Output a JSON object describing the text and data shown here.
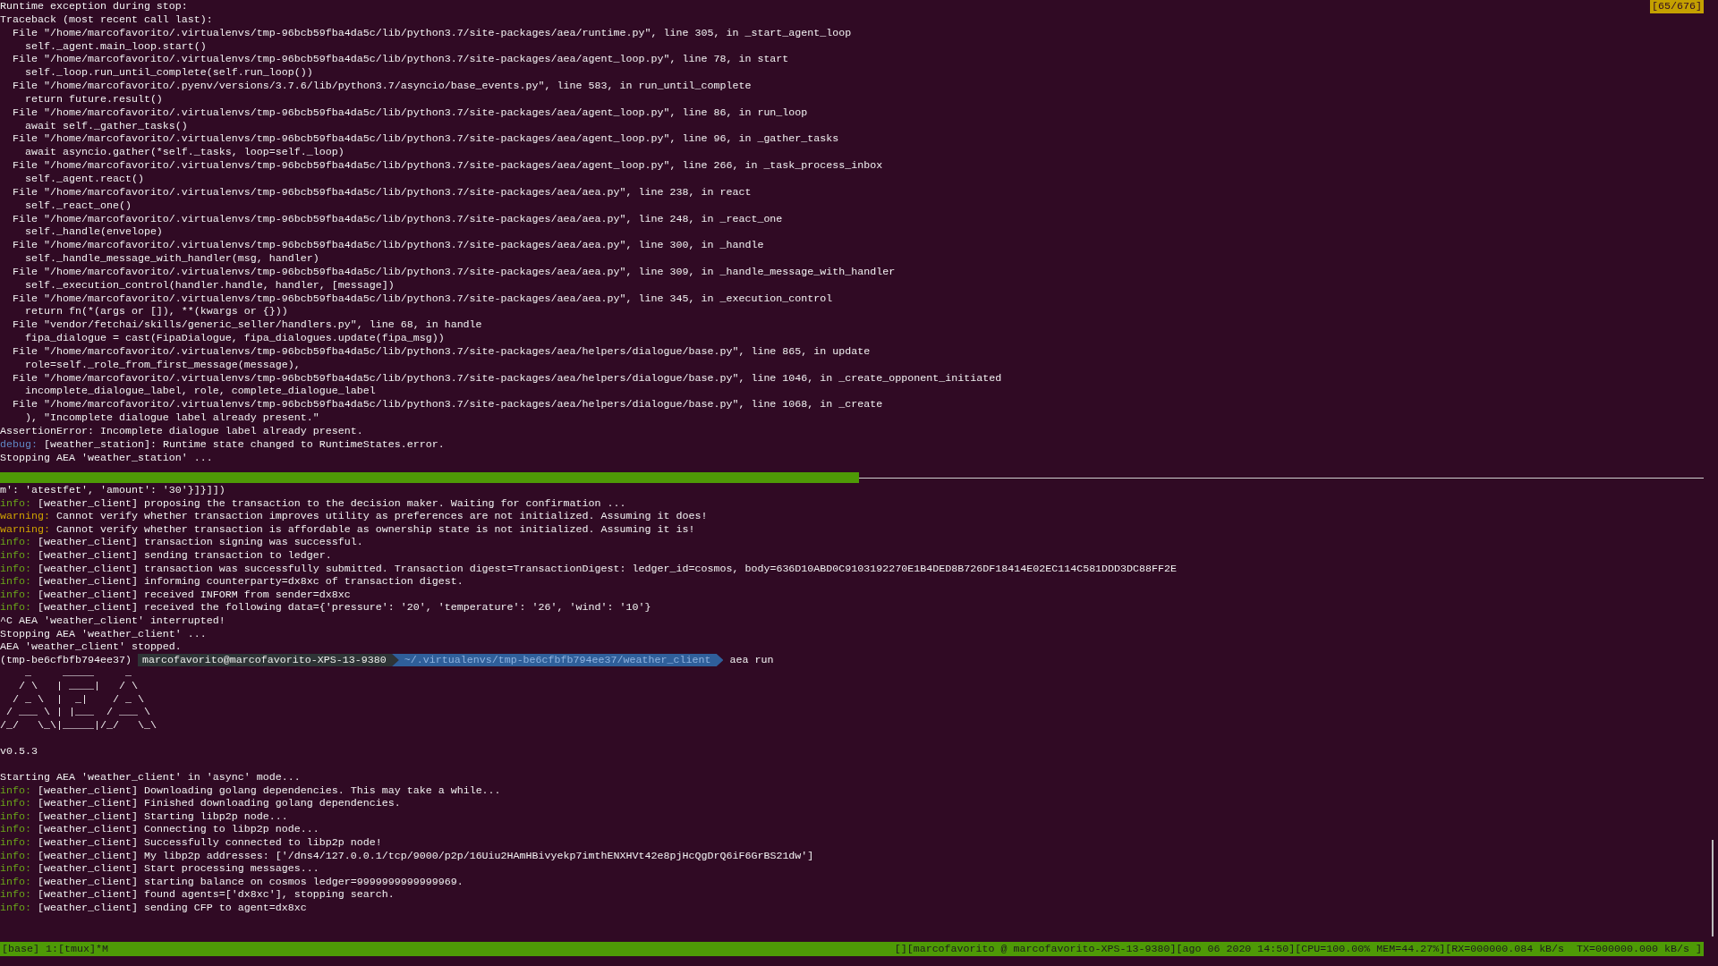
{
  "top_pane": {
    "badge": "[65/676]",
    "lines": [
      {
        "kind": "plain",
        "text": "Runtime exception during stop:"
      },
      {
        "kind": "plain",
        "text": "Traceback (most recent call last):"
      },
      {
        "kind": "plain",
        "text": "  File \"/home/marcofavorito/.virtualenvs/tmp-96bcb59fba4da5c/lib/python3.7/site-packages/aea/runtime.py\", line 305, in _start_agent_loop"
      },
      {
        "kind": "plain",
        "text": "    self._agent.main_loop.start()"
      },
      {
        "kind": "plain",
        "text": "  File \"/home/marcofavorito/.virtualenvs/tmp-96bcb59fba4da5c/lib/python3.7/site-packages/aea/agent_loop.py\", line 78, in start"
      },
      {
        "kind": "plain",
        "text": "    self._loop.run_until_complete(self.run_loop())"
      },
      {
        "kind": "plain",
        "text": "  File \"/home/marcofavorito/.pyenv/versions/3.7.6/lib/python3.7/asyncio/base_events.py\", line 583, in run_until_complete"
      },
      {
        "kind": "plain",
        "text": "    return future.result()"
      },
      {
        "kind": "plain",
        "text": "  File \"/home/marcofavorito/.virtualenvs/tmp-96bcb59fba4da5c/lib/python3.7/site-packages/aea/agent_loop.py\", line 86, in run_loop"
      },
      {
        "kind": "plain",
        "text": "    await self._gather_tasks()"
      },
      {
        "kind": "plain",
        "text": "  File \"/home/marcofavorito/.virtualenvs/tmp-96bcb59fba4da5c/lib/python3.7/site-packages/aea/agent_loop.py\", line 96, in _gather_tasks"
      },
      {
        "kind": "plain",
        "text": "    await asyncio.gather(*self._tasks, loop=self._loop)"
      },
      {
        "kind": "plain",
        "text": "  File \"/home/marcofavorito/.virtualenvs/tmp-96bcb59fba4da5c/lib/python3.7/site-packages/aea/agent_loop.py\", line 266, in _task_process_inbox"
      },
      {
        "kind": "plain",
        "text": "    self._agent.react()"
      },
      {
        "kind": "plain",
        "text": "  File \"/home/marcofavorito/.virtualenvs/tmp-96bcb59fba4da5c/lib/python3.7/site-packages/aea/aea.py\", line 238, in react"
      },
      {
        "kind": "plain",
        "text": "    self._react_one()"
      },
      {
        "kind": "plain",
        "text": "  File \"/home/marcofavorito/.virtualenvs/tmp-96bcb59fba4da5c/lib/python3.7/site-packages/aea/aea.py\", line 248, in _react_one"
      },
      {
        "kind": "plain",
        "text": "    self._handle(envelope)"
      },
      {
        "kind": "plain",
        "text": "  File \"/home/marcofavorito/.virtualenvs/tmp-96bcb59fba4da5c/lib/python3.7/site-packages/aea/aea.py\", line 300, in _handle"
      },
      {
        "kind": "plain",
        "text": "    self._handle_message_with_handler(msg, handler)"
      },
      {
        "kind": "plain",
        "text": "  File \"/home/marcofavorito/.virtualenvs/tmp-96bcb59fba4da5c/lib/python3.7/site-packages/aea/aea.py\", line 309, in _handle_message_with_handler"
      },
      {
        "kind": "plain",
        "text": "    self._execution_control(handler.handle, handler, [message])"
      },
      {
        "kind": "plain",
        "text": "  File \"/home/marcofavorito/.virtualenvs/tmp-96bcb59fba4da5c/lib/python3.7/site-packages/aea/aea.py\", line 345, in _execution_control"
      },
      {
        "kind": "plain",
        "text": "    return fn(*(args or []), **(kwargs or {}))"
      },
      {
        "kind": "plain",
        "text": "  File \"vendor/fetchai/skills/generic_seller/handlers.py\", line 68, in handle"
      },
      {
        "kind": "plain",
        "text": "    fipa_dialogue = cast(FipaDialogue, fipa_dialogues.update(fipa_msg))"
      },
      {
        "kind": "plain",
        "text": "  File \"/home/marcofavorito/.virtualenvs/tmp-96bcb59fba4da5c/lib/python3.7/site-packages/aea/helpers/dialogue/base.py\", line 865, in update"
      },
      {
        "kind": "plain",
        "text": "    role=self._role_from_first_message(message),"
      },
      {
        "kind": "plain",
        "text": "  File \"/home/marcofavorito/.virtualenvs/tmp-96bcb59fba4da5c/lib/python3.7/site-packages/aea/helpers/dialogue/base.py\", line 1046, in _create_opponent_initiated"
      },
      {
        "kind": "plain",
        "text": "    incomplete_dialogue_label, role, complete_dialogue_label"
      },
      {
        "kind": "plain",
        "text": "  File \"/home/marcofavorito/.virtualenvs/tmp-96bcb59fba4da5c/lib/python3.7/site-packages/aea/helpers/dialogue/base.py\", line 1068, in _create"
      },
      {
        "kind": "plain",
        "text": "    ), \"Incomplete dialogue label already present.\""
      },
      {
        "kind": "plain",
        "text": "AssertionError: Incomplete dialogue label already present."
      },
      {
        "kind": "log",
        "color": "#5f87c4",
        "prefix": "debug:",
        "text": "[weather_station]: Runtime state changed to RuntimeStates.error."
      },
      {
        "kind": "plain",
        "text": "Stopping AEA 'weather_station' ..."
      }
    ]
  },
  "bottom_pane": {
    "lines": [
      {
        "kind": "plain",
        "text": "m': 'atestfet', 'amount': '30'}]}]])"
      },
      {
        "kind": "log",
        "color": "#6aa61a",
        "prefix": "info:",
        "text": "[weather_client] proposing the transaction to the decision maker. Waiting for confirmation ..."
      },
      {
        "kind": "log",
        "color": "#d0a400",
        "prefix": "warning:",
        "text": "Cannot verify whether transaction improves utility as preferences are not initialized. Assuming it does!"
      },
      {
        "kind": "log",
        "color": "#d0a400",
        "prefix": "warning:",
        "text": "Cannot verify whether transaction is affordable as ownership state is not initialized. Assuming it is!"
      },
      {
        "kind": "log",
        "color": "#6aa61a",
        "prefix": "info:",
        "text": "[weather_client] transaction signing was successful."
      },
      {
        "kind": "log",
        "color": "#6aa61a",
        "prefix": "info:",
        "text": "[weather_client] sending transaction to ledger."
      },
      {
        "kind": "log",
        "color": "#6aa61a",
        "prefix": "info:",
        "text": "[weather_client] transaction was successfully submitted. Transaction digest=TransactionDigest: ledger_id=cosmos, body=636D10ABD0C9103192270E1B4DED8B726DF18414E02EC114C581DDD3DC88FF2E"
      },
      {
        "kind": "log",
        "color": "#6aa61a",
        "prefix": "info:",
        "text": "[weather_client] informing counterparty=dx8xc of transaction digest."
      },
      {
        "kind": "log",
        "color": "#6aa61a",
        "prefix": "info:",
        "text": "[weather_client] received INFORM from sender=dx8xc"
      },
      {
        "kind": "log",
        "color": "#6aa61a",
        "prefix": "info:",
        "text": "[weather_client] received the following data={'pressure': '20', 'temperature': '26', 'wind': '10'}"
      },
      {
        "kind": "plain",
        "text": "^C AEA 'weather_client' interrupted!"
      },
      {
        "kind": "plain",
        "text": "Stopping AEA 'weather_client' ..."
      },
      {
        "kind": "plain",
        "text": "AEA 'weather_client' stopped."
      },
      {
        "kind": "prompt",
        "env": "(tmp-be6cfbfb794ee37)",
        "user_host": "marcofavorito@marcofavorito-XPS-13-9380",
        "path": "~/.virtualenvs/tmp-be6cfbfb794ee37/weather_client",
        "command": "aea run"
      },
      {
        "kind": "art",
        "lines": [
          "    _     _____     _",
          "   / \\   | ____|   / \\",
          "  / _ \\  |  _|    / _ \\",
          " / ___ \\ | |___  / ___ \\",
          "/_/   \\_\\|_____|/_/   \\_\\"
        ]
      },
      {
        "kind": "blank"
      },
      {
        "kind": "plain",
        "text": "v0.5.3"
      },
      {
        "kind": "blank"
      },
      {
        "kind": "plain",
        "text": "Starting AEA 'weather_client' in 'async' mode..."
      },
      {
        "kind": "log",
        "color": "#6aa61a",
        "prefix": "info:",
        "text": "[weather_client] Downloading golang dependencies. This may take a while..."
      },
      {
        "kind": "log",
        "color": "#6aa61a",
        "prefix": "info:",
        "text": "[weather_client] Finished downloading golang dependencies."
      },
      {
        "kind": "log",
        "color": "#6aa61a",
        "prefix": "info:",
        "text": "[weather_client] Starting libp2p node..."
      },
      {
        "kind": "log",
        "color": "#6aa61a",
        "prefix": "info:",
        "text": "[weather_client] Connecting to libp2p node..."
      },
      {
        "kind": "log",
        "color": "#6aa61a",
        "prefix": "info:",
        "text": "[weather_client] Successfully connected to libp2p node!"
      },
      {
        "kind": "log",
        "color": "#6aa61a",
        "prefix": "info:",
        "text": "[weather_client] My libp2p addresses: ['/dns4/127.0.0.1/tcp/9000/p2p/16Uiu2HAmHBivyekp7imthENXHVt42e8pjHcQgDrQ6iF6GrBS21dw']"
      },
      {
        "kind": "log",
        "color": "#6aa61a",
        "prefix": "info:",
        "text": "[weather_client] Start processing messages..."
      },
      {
        "kind": "log",
        "color": "#6aa61a",
        "prefix": "info:",
        "text": "[weather_client] starting balance on cosmos ledger=9999999999999969."
      },
      {
        "kind": "log",
        "color": "#6aa61a",
        "prefix": "info:",
        "text": "[weather_client] found agents=['dx8xc'], stopping search."
      },
      {
        "kind": "log",
        "color": "#6aa61a",
        "prefix": "info:",
        "text": "[weather_client] sending CFP to agent=dx8xc"
      }
    ]
  },
  "status_bar": {
    "left": "[base] 1:[tmux]*M",
    "right": "[][marcofavorito @ marcofavorito-XPS-13-9380][ago 06 2020 14:50][CPU=100.00% MEM=44.27%][RX=000000.084 kB/s  TX=000000.000 kB/s ]"
  }
}
